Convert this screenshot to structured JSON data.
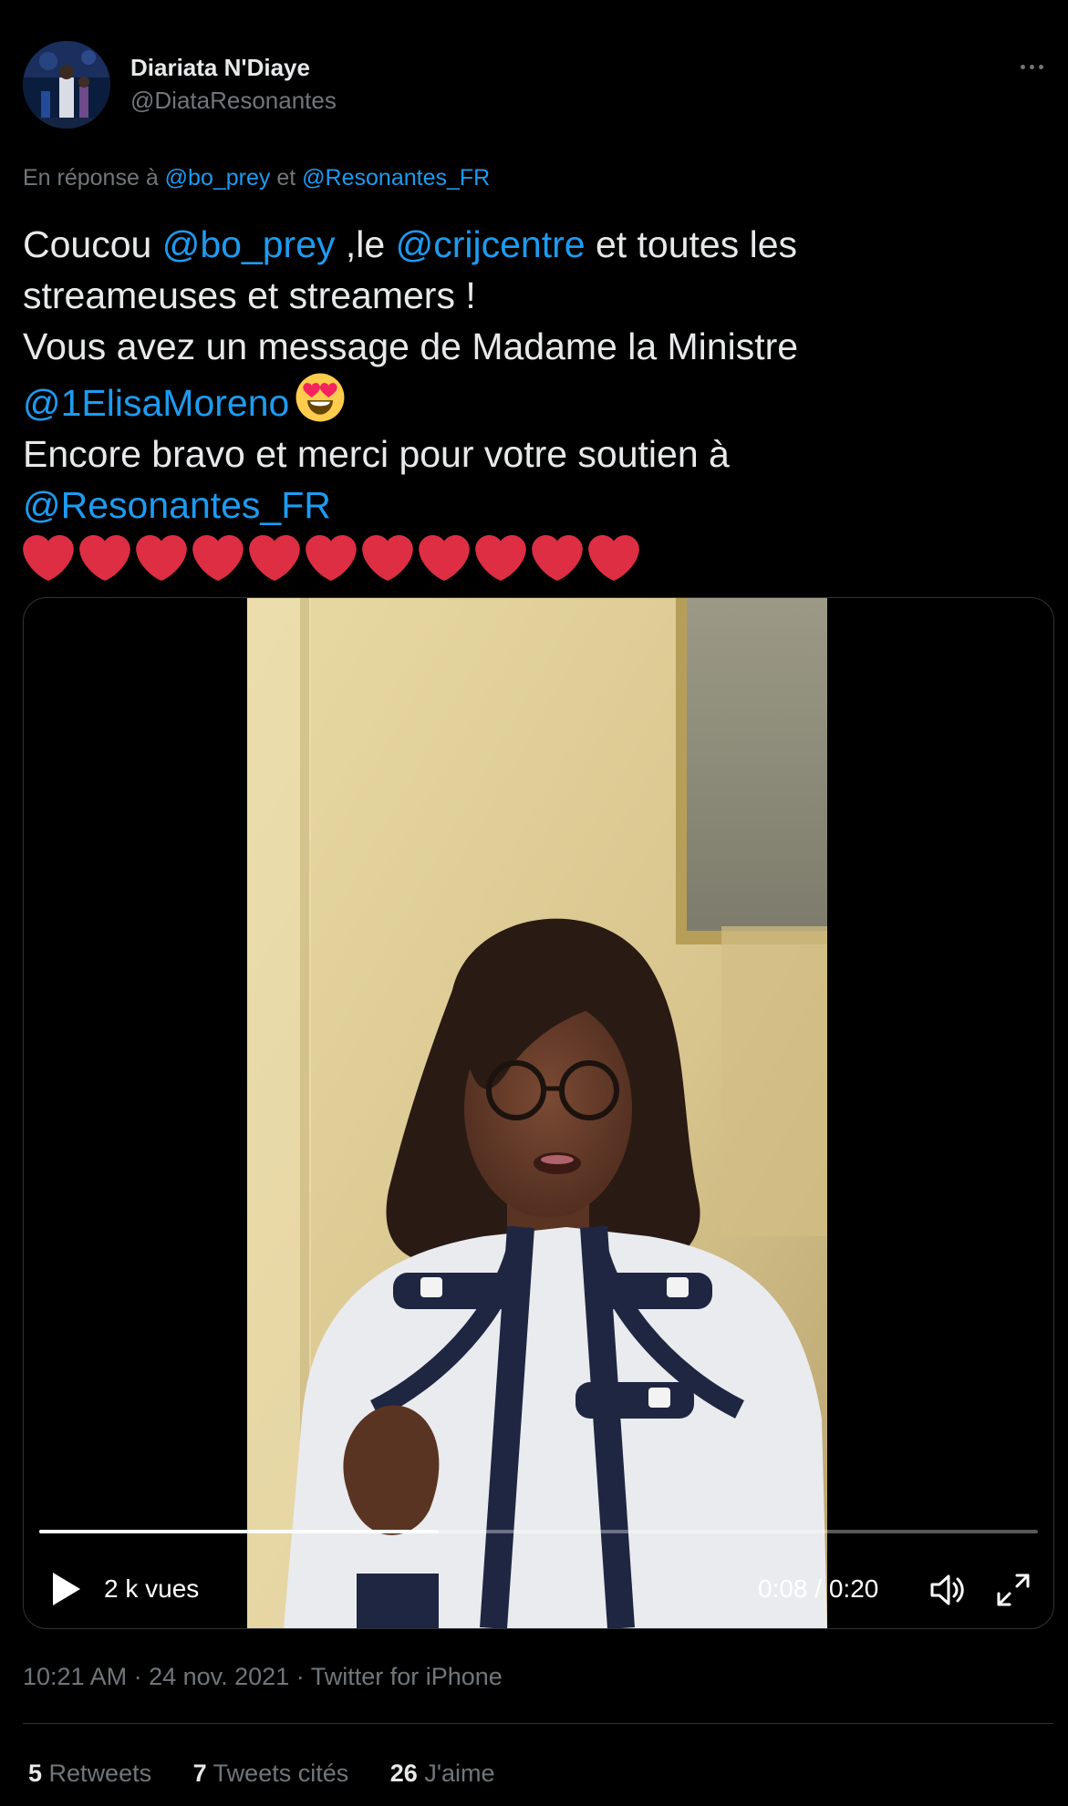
{
  "colors": {
    "background": "#000000",
    "text_primary": "#e7e9ea",
    "text_secondary": "#71767b",
    "link": "#1d9bf0",
    "divider": "#2f3336",
    "heart": "#dd2e44"
  },
  "author": {
    "display_name": "Diariata N'Diaye",
    "handle": "@DiataResonantes"
  },
  "reply_context": {
    "prefix": "En réponse à",
    "mention_1": "@bo_prey",
    "joiner": "et",
    "mention_2": "@Resonantes_FR"
  },
  "tweet": {
    "l1_a": "Coucou ",
    "l1_mention": "@bo_prey",
    "l1_b": " ,le ",
    "l1_mention_2": "@crijcentre",
    "l1_c": " et toutes les",
    "l2": "streameuses et streamers !",
    "l3": "Vous avez un message de Madame la Ministre",
    "l4_mention": "@1ElisaMoreno",
    "l4_emoji": "smiling-face-with-heart-eyes",
    "l5": "Encore bravo et merci pour votre soutien à",
    "l6_mention": "@Resonantes_FR",
    "hearts_count": 11
  },
  "video": {
    "views": "2 k vues",
    "current_time": "0:08",
    "separator": " / ",
    "duration": "0:20",
    "progress_fraction": 0.4
  },
  "meta": {
    "time": "10:21 AM",
    "dot": " · ",
    "date": "24 nov. 2021",
    "source": "Twitter for iPhone"
  },
  "stats": {
    "retweets_count": "5",
    "retweets_label": "Retweets",
    "quotes_count": "7",
    "quotes_label": "Tweets cités",
    "likes_count": "26",
    "likes_label": "J'aime"
  }
}
